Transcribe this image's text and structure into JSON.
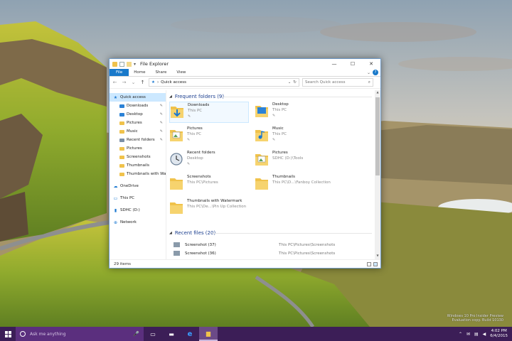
{
  "window": {
    "title": "File Explorer",
    "controls": {
      "minimize": "—",
      "maximize": "☐",
      "close": "✕"
    }
  },
  "ribbon": {
    "tabs": [
      "File",
      "Home",
      "Share",
      "View"
    ],
    "help": "?",
    "expand": "⌄"
  },
  "address_bar": {
    "back": "←",
    "forward": "→",
    "recent": "⌄",
    "up": "↑",
    "path_separator": "›",
    "path": "Quick access",
    "dropdown": "⌄",
    "refresh": "↻",
    "search_placeholder": "Search Quick access",
    "search_icon": "⌕"
  },
  "nav_pane": {
    "items": [
      {
        "label": "Quick access",
        "icon": "star-icon",
        "level": 0,
        "selected": true,
        "pinned": false
      },
      {
        "label": "Downloads",
        "icon": "downloads-folder-icon",
        "level": 1,
        "pinned": true
      },
      {
        "label": "Desktop",
        "icon": "desktop-folder-icon",
        "level": 1,
        "pinned": true
      },
      {
        "label": "Pictures",
        "icon": "pictures-folder-icon",
        "level": 1,
        "pinned": true
      },
      {
        "label": "Music",
        "icon": "music-folder-icon",
        "level": 1,
        "pinned": true
      },
      {
        "label": "Recent folders",
        "icon": "recent-folders-icon",
        "level": 1,
        "pinned": true
      },
      {
        "label": "Pictures",
        "icon": "folder-icon",
        "level": 1,
        "pinned": false
      },
      {
        "label": "Screenshots",
        "icon": "folder-icon",
        "level": 1,
        "pinned": false
      },
      {
        "label": "Thumbnails",
        "icon": "folder-icon",
        "level": 1,
        "pinned": false
      },
      {
        "label": "Thumbnails with Wat",
        "icon": "folder-icon",
        "level": 1,
        "pinned": false
      },
      {
        "label": "OneDrive",
        "icon": "onedrive-icon",
        "level": 0,
        "gap": true
      },
      {
        "label": "This PC",
        "icon": "this-pc-icon",
        "level": 0,
        "gap": true
      },
      {
        "label": "SDHC (D:)",
        "icon": "sd-card-icon",
        "level": 0,
        "gap": true
      },
      {
        "label": "Network",
        "icon": "network-icon",
        "level": 0,
        "gap": true
      }
    ],
    "pin_glyph": "✎"
  },
  "frequent_folders": {
    "heading": "Frequent folders (9)",
    "collapse_glyph": "◢",
    "pin_glyph": "✎",
    "items": [
      {
        "name": "Downloads",
        "sub": "This PC",
        "pinned": true,
        "icon": "downloads-folder-icon",
        "selected": true
      },
      {
        "name": "Desktop",
        "sub": "This PC",
        "pinned": true,
        "icon": "desktop-folder-icon"
      },
      {
        "name": "Pictures",
        "sub": "This PC",
        "pinned": true,
        "icon": "pictures-folder-icon"
      },
      {
        "name": "Music",
        "sub": "This PC",
        "pinned": true,
        "icon": "music-folder-icon"
      },
      {
        "name": "Recent folders",
        "sub": "Desktop",
        "pinned": true,
        "icon": "recent-folders-icon"
      },
      {
        "name": "Pictures",
        "sub": "SDHC (D:)\\Tools",
        "pinned": false,
        "icon": "pictures-folder-icon"
      },
      {
        "name": "Screenshots",
        "sub": "This PC\\Pictures",
        "pinned": false,
        "icon": "folder-icon"
      },
      {
        "name": "Thumbnails",
        "sub": "This PC\\D...\\Fanboy Collection",
        "pinned": false,
        "icon": "folder-icon"
      },
      {
        "name": "Thumbnails with Watermark",
        "sub": "This PC\\De...\\Pin Up Collection",
        "pinned": false,
        "icon": "folder-icon"
      }
    ]
  },
  "recent_files": {
    "heading": "Recent files (20)",
    "collapse_glyph": "◢",
    "items": [
      {
        "name": "Screenshot (37)",
        "path": "This PC\\Pictures\\Screenshots"
      },
      {
        "name": "Screenshot (36)",
        "path": "This PC\\Pictures\\Screenshots"
      }
    ]
  },
  "status_bar": {
    "count": "29 items"
  },
  "taskbar": {
    "search_placeholder": "Ask me anything",
    "mic": "🎤",
    "task_view": "▭",
    "store": "▬",
    "edge": "e",
    "explorer": "▆",
    "tray_up": "⌃",
    "tray_message": "✉",
    "tray_network": "▤",
    "tray_volume": "◀",
    "time": "4:02 PM",
    "date": "6/4/2015"
  },
  "desktop": {
    "watermark_line1": "Windows 10 Pro Insider Preview",
    "watermark_line2": "Evaluation copy. Build 10130"
  },
  "colors": {
    "accent": "#1979ca",
    "taskbar": "#3c1e57",
    "search_box": "#5b2f7e",
    "folder": "#f0c24b"
  }
}
